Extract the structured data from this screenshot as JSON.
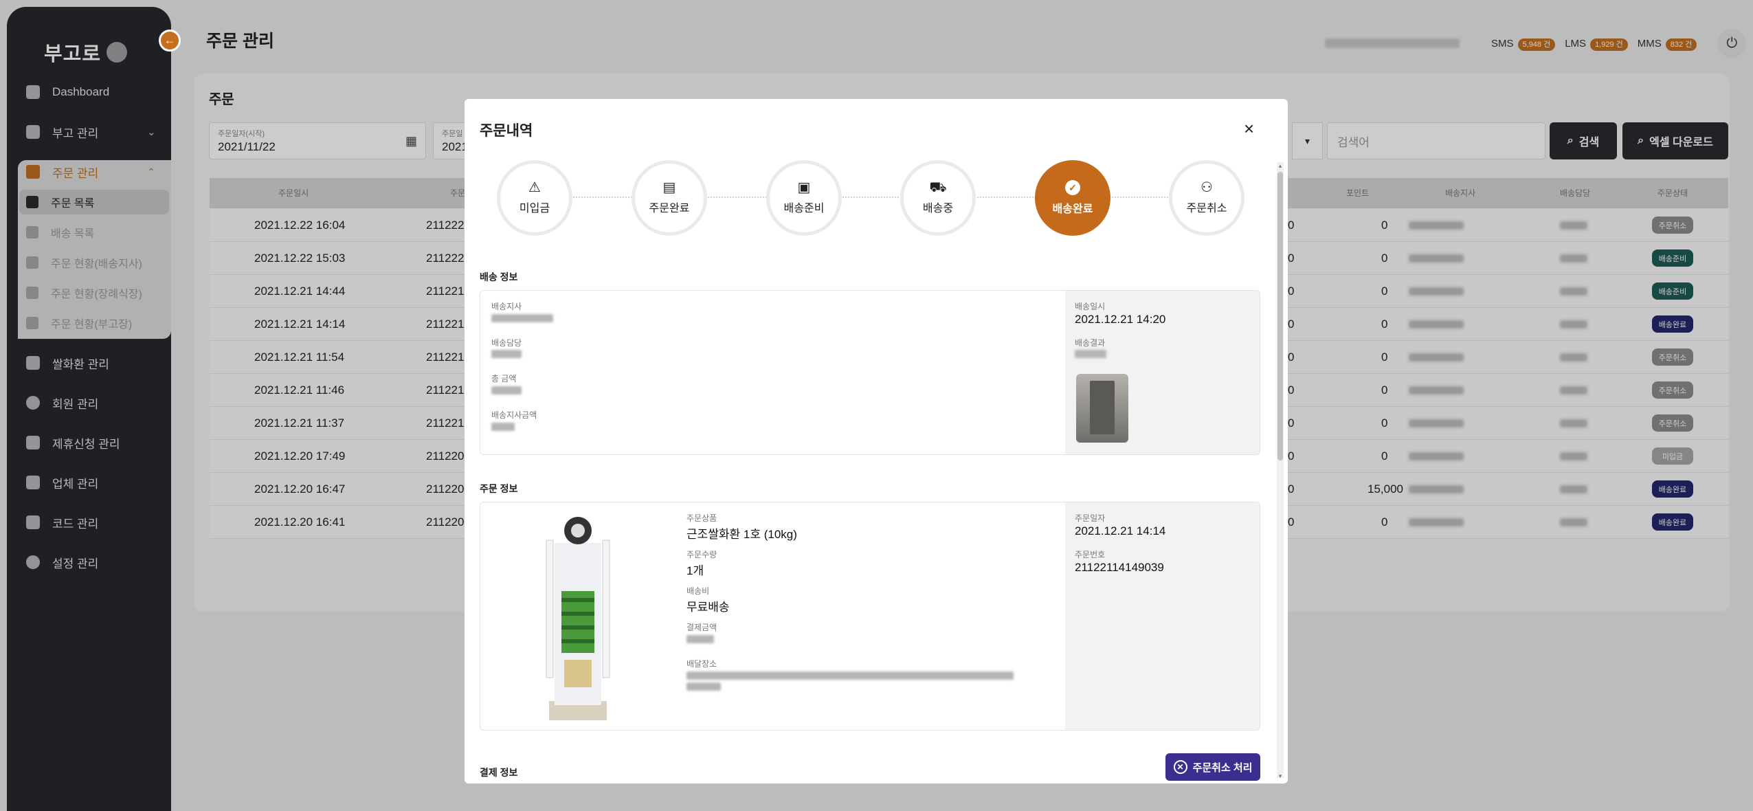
{
  "sidebar": {
    "logo": "부고로",
    "collapse_icon": "arrow-left-icon",
    "items": [
      {
        "label": "Dashboard",
        "icon": "home-icon"
      },
      {
        "label": "부고 관리",
        "icon": "clipboard-icon"
      },
      {
        "label": "주문 관리",
        "icon": "cart-icon"
      },
      {
        "label": "쌀화환 관리",
        "icon": "gift-icon"
      },
      {
        "label": "회원 관리",
        "icon": "user-icon"
      },
      {
        "label": "제휴신청 관리",
        "icon": "handshake-icon"
      },
      {
        "label": "업체 관리",
        "icon": "building-icon"
      },
      {
        "label": "코드 관리",
        "icon": "cube-icon"
      },
      {
        "label": "설정 관리",
        "icon": "gear-icon"
      }
    ],
    "sub_items": [
      {
        "label": "주문 목록"
      },
      {
        "label": "배송 목록"
      },
      {
        "label": "주문 현황(배송지사)"
      },
      {
        "label": "주문 현황(장례식장)"
      },
      {
        "label": "주문 현황(부고장)"
      }
    ]
  },
  "header": {
    "title": "주문 관리",
    "sms_label": "SMS",
    "sms_count": "5,948 건",
    "lms_label": "LMS",
    "lms_count": "1,929 건",
    "mms_label": "MMS",
    "mms_count": "832 건",
    "power_icon": "power-icon"
  },
  "main": {
    "card_title": "주문",
    "date_start_label": "주문일자(시작)",
    "date_start_value": "2021/11/22",
    "date_end_label": "주문일",
    "date_end_value": "2021",
    "search_placeholder": "검색어",
    "search_button": "검색",
    "excel_button": "엑셀 다운로드",
    "columns": [
      "주문일시",
      "주문",
      "포인트",
      "배송지사",
      "배송담당",
      "주문상태"
    ],
    "rows": [
      {
        "date": "2021.12.22 16:04",
        "order": "211222",
        "c1": "0",
        "c2": "0",
        "status": "주문취소",
        "status_color": "#8c8c8c"
      },
      {
        "date": "2021.12.22 15:03",
        "order": "211222",
        "c1": "0",
        "c2": "0",
        "status": "배송준비",
        "status_color": "#1f5d57"
      },
      {
        "date": "2021.12.21 14:44",
        "order": "211221",
        "c1": "0",
        "c2": "0",
        "status": "배송준비",
        "status_color": "#1f5d57"
      },
      {
        "date": "2021.12.21 14:14",
        "order": "211221",
        "c1": "0",
        "c2": "0",
        "status": "배송완료",
        "status_color": "#24276e"
      },
      {
        "date": "2021.12.21 11:54",
        "order": "211221",
        "c1": "0",
        "c2": "0",
        "status": "주문취소",
        "status_color": "#8c8c8c"
      },
      {
        "date": "2021.12.21 11:46",
        "order": "211221",
        "c1": "0",
        "c2": "0",
        "status": "주문취소",
        "status_color": "#8c8c8c"
      },
      {
        "date": "2021.12.21 11:37",
        "order": "211221",
        "c1": "0",
        "c2": "0",
        "status": "주문취소",
        "status_color": "#8c8c8c"
      },
      {
        "date": "2021.12.20 17:49",
        "order": "211220",
        "c1": "0",
        "c2": "0",
        "status": "미입금",
        "status_color": "#a8a8a8"
      },
      {
        "date": "2021.12.20 16:47",
        "order": "211220",
        "c1": "0",
        "c2": "15,000",
        "status": "배송완료",
        "status_color": "#24276e"
      },
      {
        "date": "2021.12.20 16:41",
        "order": "211220",
        "c1": "0",
        "c2": "0",
        "status": "배송완료",
        "status_color": "#24276e"
      }
    ]
  },
  "modal": {
    "title": "주문내역",
    "close_icon": "close-icon",
    "steps": [
      {
        "label": "미입금",
        "icon": "warning-icon"
      },
      {
        "label": "주문완료",
        "icon": "document-check-icon"
      },
      {
        "label": "배송준비",
        "icon": "gift-icon"
      },
      {
        "label": "배송중",
        "icon": "truck-icon"
      },
      {
        "label": "배송완료",
        "icon": "check-circle-icon"
      },
      {
        "label": "주문취소",
        "icon": "user-x-icon"
      }
    ],
    "active_step": "배송완료",
    "delivery_section": "배송 정보",
    "delivery": {
      "branch_label": "배송지사",
      "manager_label": "배송담당",
      "total_label": "총 금액",
      "branch_amount_label": "배송지사금액",
      "date_label": "배송일시",
      "date_value": "2021.12.21 14:20",
      "result_label": "배송결과"
    },
    "order_section": "주문 정보",
    "order": {
      "product_label": "주문상품",
      "product_value": "근조쌀화환 1호 (10kg)",
      "qty_label": "주문수량",
      "qty_value": "1개",
      "fee_label": "배송비",
      "fee_value": "무료배송",
      "pay_amount_label": "결제금액",
      "place_label": "배달장소",
      "order_date_label": "주문일자",
      "order_date_value": "2021.12.21 14:14",
      "order_no_label": "주문번호",
      "order_no_value": "21122114149039"
    },
    "payment_section": "결제 정보",
    "cancel_button": "주문취소 처리"
  },
  "colors": {
    "accent": "#c27020",
    "sidebar_bg": "#29292d",
    "active_step": "#c46a1a",
    "cancel_button": "#3a2e8f"
  }
}
